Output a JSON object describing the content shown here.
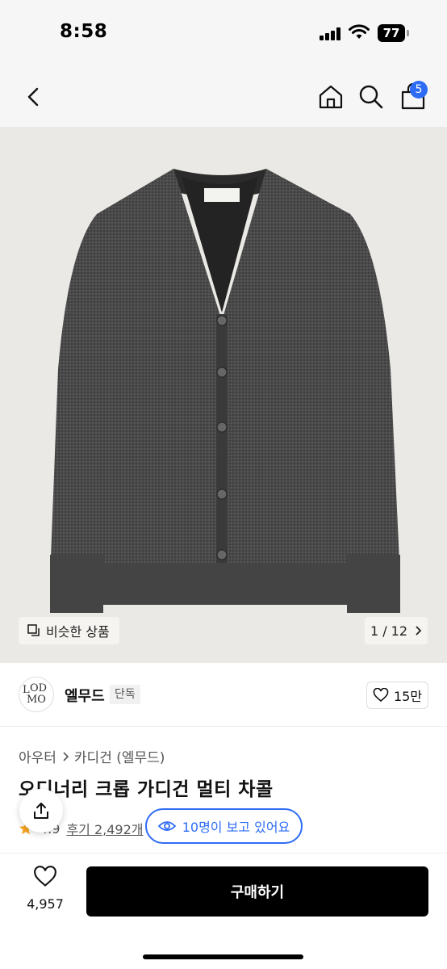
{
  "status_bar": {
    "time": "8:58",
    "battery": "77"
  },
  "nav": {
    "cart_badge": "5",
    "icons": [
      "back-icon",
      "home-icon",
      "search-icon",
      "shopping-bag-icon"
    ]
  },
  "gallery": {
    "similar_label": "비슷한 상품",
    "counter": "1 / 12"
  },
  "brand": {
    "name": "엘무드",
    "tag": "단독",
    "likes": "15만"
  },
  "product": {
    "category": [
      "아우터",
      "카디건 (엘무드)"
    ],
    "title": "오디너리 크롭 가디건 멀티 차콜",
    "rating": "4.9",
    "reviews": "후기 2,492개"
  },
  "viewers": {
    "text": "10명이 보고 있어요"
  },
  "bottom": {
    "wish_count": "4,957",
    "buy_label": "구매하기"
  },
  "colors": {
    "accent": "#2e6cf6",
    "buy_button": "#000000",
    "image_background": "#ebe9e5",
    "star": "#f5a623"
  }
}
